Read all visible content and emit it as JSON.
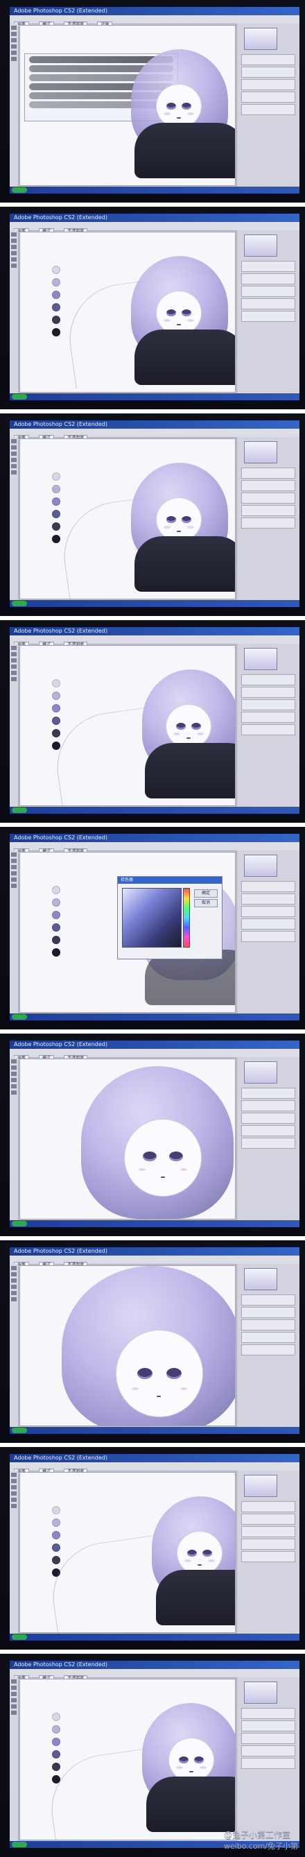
{
  "app": {
    "window_title_sample": "Adobe Photoshop CS2 (Extended)",
    "watermark": {
      "line1": "@兔子小第工作室",
      "line2": "weibo.com/兔子小第"
    }
  },
  "ui": {
    "option_chips": [
      "画笔",
      "模式",
      "不透明度",
      "流量"
    ],
    "color_picker": {
      "title": "拾色器",
      "ok_label": "确定",
      "cancel_label": "取消"
    }
  },
  "colors": {
    "swatches": [
      "#d9d6e8",
      "#b8b2d9",
      "#8f86c9",
      "#5b5c8f",
      "#3a3b52",
      "#1a1b2d"
    ]
  },
  "frames": [
    {
      "id": "1",
      "has_brush_panel": true,
      "has_color_dialog": false
    },
    {
      "id": "2",
      "has_brush_panel": false,
      "has_color_dialog": false
    },
    {
      "id": "3",
      "has_brush_panel": false,
      "has_color_dialog": false
    },
    {
      "id": "4",
      "has_brush_panel": false,
      "has_color_dialog": false
    },
    {
      "id": "5",
      "has_brush_panel": false,
      "has_color_dialog": true
    },
    {
      "id": "6",
      "has_brush_panel": false,
      "has_color_dialog": false
    },
    {
      "id": "7",
      "has_brush_panel": false,
      "has_color_dialog": false
    },
    {
      "id": "8",
      "has_brush_panel": false,
      "has_color_dialog": false
    },
    {
      "id": "9",
      "has_brush_panel": false,
      "has_color_dialog": false
    }
  ]
}
